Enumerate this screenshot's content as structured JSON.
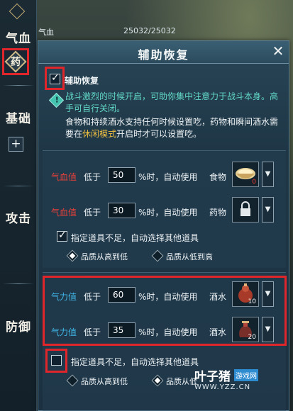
{
  "hp_bar": {
    "label": "气血",
    "value": "25032/25032"
  },
  "left_nav": {
    "items": [
      {
        "label": "气血"
      },
      {
        "label": "药"
      },
      {
        "label": "基础"
      },
      {
        "label": "攻击"
      },
      {
        "label": "防御"
      }
    ],
    "plus_symbol": "+"
  },
  "dialog": {
    "title": "辅助恢复",
    "close_symbol": "✕",
    "enable_label": "辅助恢复",
    "enable_checked": true,
    "tip": "战斗激烈的时候开启，可助你集中注意力于战斗本身。高手可自行关闭。",
    "desc_before": "食物和持续酒水支持任何时候设置吃，药物和瞬间酒水需要在",
    "desc_highlight": "休闲模式",
    "desc_after": "开启时才可以设置吃。",
    "rows": [
      {
        "stat": "气血值",
        "below": "低于",
        "value": "50",
        "suffix": "%时，自动使用",
        "item": "食物",
        "count": "0"
      },
      {
        "stat": "气血值",
        "below": "低于",
        "value": "30",
        "suffix": "%时，自动使用",
        "item": "药物",
        "count": ""
      }
    ],
    "section1_fallback": {
      "label": "指定道具不足，自动选择其他道具",
      "checked": true
    },
    "section1_radios": [
      {
        "label": "品质从高到低",
        "selected": true
      },
      {
        "label": "品质从低到高",
        "selected": false
      }
    ],
    "rows2": [
      {
        "stat": "气力值",
        "below": "低于",
        "value": "60",
        "suffix": "%时，自动使用",
        "item": "酒水",
        "count": "10"
      },
      {
        "stat": "气力值",
        "below": "低于",
        "value": "35",
        "suffix": "%时，自动使用",
        "item": "酒水",
        "count": "20"
      }
    ],
    "section2_fallback": {
      "label": "指定道具不足，自动选择其他道具",
      "checked": false
    },
    "section2_radios": [
      {
        "label": "品质从高到低",
        "selected": false
      },
      {
        "label": "品质从低",
        "selected": true
      }
    ]
  },
  "watermark": {
    "main": "叶子猪",
    "tag": "游戏网",
    "url": "WWW.YZZ.CN"
  },
  "colors": {
    "red_stat": "#e8413a",
    "blue_stat": "#3fb6e8",
    "highlight": "#f0c040",
    "tip": "#62d8c8",
    "annotation": "#e0262b"
  }
}
